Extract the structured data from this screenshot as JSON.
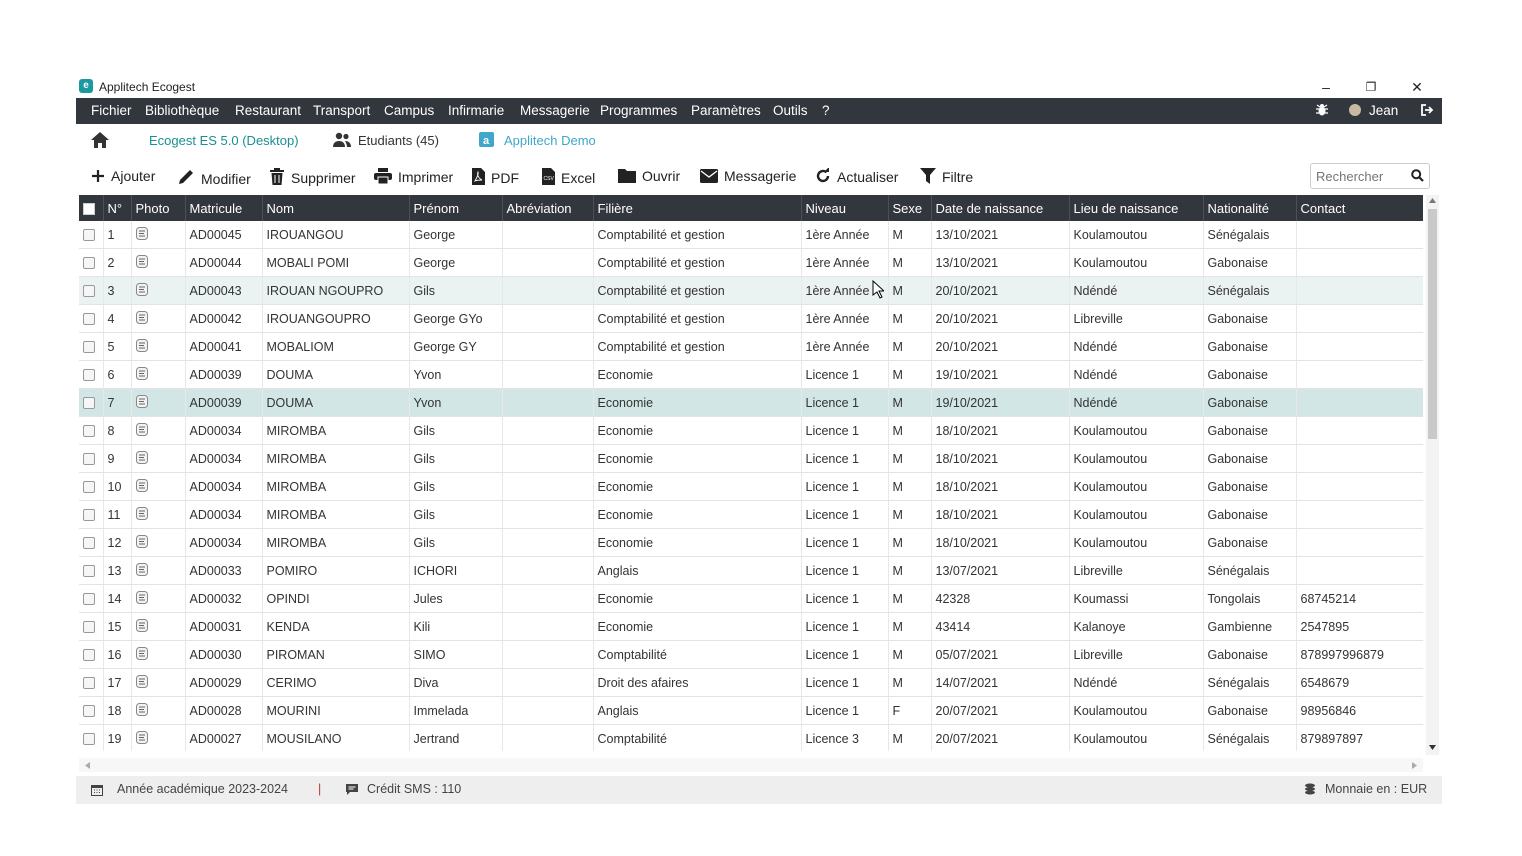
{
  "window": {
    "title": "Applitech Ecogest",
    "minimize": "–",
    "restore": "❐",
    "close": "✕"
  },
  "menu": {
    "items": [
      "Fichier",
      "Bibliothèque",
      "Restaurant",
      "Transport",
      "Campus",
      "Infirmarie",
      "Messagerie",
      "Programmes",
      "Paramètres",
      "Outils",
      "?"
    ],
    "user": "Jean"
  },
  "nav": {
    "home_icon": "home-icon",
    "version": "Ecogest ES 5.0 (Desktop)",
    "students": "Etudiants (45)",
    "company": "Applitech Demo"
  },
  "toolbar": {
    "ajouter": "Ajouter",
    "modifier": "Modifier",
    "supprimer": "Supprimer",
    "imprimer": "Imprimer",
    "pdf": "PDF",
    "excel": "Excel",
    "ouvrir": "Ouvrir",
    "messagerie": "Messagerie",
    "actualiser": "Actualiser",
    "filtre": "Filtre",
    "search_placeholder": "Rechercher"
  },
  "table": {
    "columns": [
      "N°",
      "Photo",
      "Matricule",
      "Nom",
      "Prénom",
      "Abréviation",
      "Filière",
      "Niveau",
      "Sexe",
      "Date de naissance",
      "Lieu de naissance",
      "Nationalité",
      "Contact"
    ],
    "rows": [
      {
        "n": "1",
        "matricule": "AD00045",
        "nom": "IROUANGOU",
        "prenom": "George",
        "abrev": "",
        "filiere": "Comptabilité et gestion",
        "niveau": "1ère Année",
        "sexe": "M",
        "naissance": "13/10/2021",
        "lieu": "Koulamoutou",
        "nationalite": "Sénégalais",
        "contact": ""
      },
      {
        "n": "2",
        "matricule": "AD00044",
        "nom": "MOBALI POMI",
        "prenom": "George",
        "abrev": "",
        "filiere": "Comptabilité et gestion",
        "niveau": "1ère Année",
        "sexe": "M",
        "naissance": "13/10/2021",
        "lieu": "Koulamoutou",
        "nationalite": "Gabonaise",
        "contact": ""
      },
      {
        "n": "3",
        "matricule": "AD00043",
        "nom": "IROUAN NGOUPRO",
        "prenom": "Gils",
        "abrev": "",
        "filiere": "Comptabilité et gestion",
        "niveau": "1ère Année",
        "sexe": "M",
        "naissance": "20/10/2021",
        "lieu": "Ndéndé",
        "nationalite": "Sénégalais",
        "contact": ""
      },
      {
        "n": "4",
        "matricule": "AD00042",
        "nom": "IROUANGOUPRO",
        "prenom": "George GYo",
        "abrev": "",
        "filiere": "Comptabilité et gestion",
        "niveau": "1ère Année",
        "sexe": "M",
        "naissance": "20/10/2021",
        "lieu": "Libreville",
        "nationalite": "Gabonaise",
        "contact": ""
      },
      {
        "n": "5",
        "matricule": "AD00041",
        "nom": "MOBALIOM",
        "prenom": "George GY",
        "abrev": "",
        "filiere": "Comptabilité et gestion",
        "niveau": "1ère Année",
        "sexe": "M",
        "naissance": "20/10/2021",
        "lieu": "Ndéndé",
        "nationalite": "Gabonaise",
        "contact": ""
      },
      {
        "n": "6",
        "matricule": "AD00039",
        "nom": "DOUMA",
        "prenom": "Yvon",
        "abrev": "",
        "filiere": "Economie",
        "niveau": "Licence 1",
        "sexe": "M",
        "naissance": "19/10/2021",
        "lieu": "Ndéndé",
        "nationalite": "Gabonaise",
        "contact": ""
      },
      {
        "n": "7",
        "matricule": "AD00039",
        "nom": "DOUMA",
        "prenom": "Yvon",
        "abrev": "",
        "filiere": "Economie",
        "niveau": "Licence 1",
        "sexe": "M",
        "naissance": "19/10/2021",
        "lieu": "Ndéndé",
        "nationalite": "Gabonaise",
        "contact": ""
      },
      {
        "n": "8",
        "matricule": "AD00034",
        "nom": "MIROMBA",
        "prenom": "Gils",
        "abrev": "",
        "filiere": "Economie",
        "niveau": "Licence 1",
        "sexe": "M",
        "naissance": "18/10/2021",
        "lieu": "Koulamoutou",
        "nationalite": "Gabonaise",
        "contact": ""
      },
      {
        "n": "9",
        "matricule": "AD00034",
        "nom": "MIROMBA",
        "prenom": "Gils",
        "abrev": "",
        "filiere": "Economie",
        "niveau": "Licence 1",
        "sexe": "M",
        "naissance": "18/10/2021",
        "lieu": "Koulamoutou",
        "nationalite": "Gabonaise",
        "contact": ""
      },
      {
        "n": "10",
        "matricule": "AD00034",
        "nom": "MIROMBA",
        "prenom": "Gils",
        "abrev": "",
        "filiere": "Economie",
        "niveau": "Licence 1",
        "sexe": "M",
        "naissance": "18/10/2021",
        "lieu": "Koulamoutou",
        "nationalite": "Gabonaise",
        "contact": ""
      },
      {
        "n": "11",
        "matricule": "AD00034",
        "nom": "MIROMBA",
        "prenom": "Gils",
        "abrev": "",
        "filiere": "Economie",
        "niveau": "Licence 1",
        "sexe": "M",
        "naissance": "18/10/2021",
        "lieu": "Koulamoutou",
        "nationalite": "Gabonaise",
        "contact": ""
      },
      {
        "n": "12",
        "matricule": "AD00034",
        "nom": "MIROMBA",
        "prenom": "Gils",
        "abrev": "",
        "filiere": "Economie",
        "niveau": "Licence 1",
        "sexe": "M",
        "naissance": "18/10/2021",
        "lieu": "Koulamoutou",
        "nationalite": "Gabonaise",
        "contact": ""
      },
      {
        "n": "13",
        "matricule": "AD00033",
        "nom": "POMIRO",
        "prenom": "ICHORI",
        "abrev": "",
        "filiere": "Anglais",
        "niveau": "Licence 1",
        "sexe": "M",
        "naissance": "13/07/2021",
        "lieu": "Libreville",
        "nationalite": "Sénégalais",
        "contact": ""
      },
      {
        "n": "14",
        "matricule": "AD00032",
        "nom": "OPINDI",
        "prenom": "Jules",
        "abrev": "",
        "filiere": "Economie",
        "niveau": "Licence 1",
        "sexe": "M",
        "naissance": "42328",
        "lieu": "Koumassi",
        "nationalite": "Tongolais",
        "contact": "68745214"
      },
      {
        "n": "15",
        "matricule": "AD00031",
        "nom": "KENDA",
        "prenom": "Kili",
        "abrev": "",
        "filiere": "Economie",
        "niveau": "Licence 1",
        "sexe": "M",
        "naissance": "43414",
        "lieu": "Kalanoye",
        "nationalite": "Gambienne",
        "contact": "2547895"
      },
      {
        "n": "16",
        "matricule": "AD00030",
        "nom": "PIROMAN",
        "prenom": "SIMO",
        "abrev": "",
        "filiere": "Comptabilité",
        "niveau": "Licence 1",
        "sexe": "M",
        "naissance": "05/07/2021",
        "lieu": "Libreville",
        "nationalite": "Gabonaise",
        "contact": "878997996879"
      },
      {
        "n": "17",
        "matricule": "AD00029",
        "nom": "CERIMO",
        "prenom": "Diva",
        "abrev": "",
        "filiere": "Droit des afaires",
        "niveau": "Licence 1",
        "sexe": "M",
        "naissance": "14/07/2021",
        "lieu": "Ndéndé",
        "nationalite": "Sénégalais",
        "contact": "6548679"
      },
      {
        "n": "18",
        "matricule": "AD00028",
        "nom": "MOURINI",
        "prenom": "Immelada",
        "abrev": "",
        "filiere": "Anglais",
        "niveau": "Licence 1",
        "sexe": "F",
        "naissance": "20/07/2021",
        "lieu": "Koulamoutou",
        "nationalite": "Gabonaise",
        "contact": "98956846"
      },
      {
        "n": "19",
        "matricule": "AD00027",
        "nom": "MOUSILANO",
        "prenom": "Jertrand",
        "abrev": "",
        "filiere": "Comptabilité",
        "niveau": "Licence 3",
        "sexe": "M",
        "naissance": "20/07/2021",
        "lieu": "Koulamoutou",
        "nationalite": "Sénégalais",
        "contact": "879897897"
      }
    ]
  },
  "status": {
    "annee": "Année académique 2023-2024",
    "separator": "|",
    "sms": "Crédit SMS : 110",
    "monnaie": "Monnaie en : EUR"
  },
  "colors": {
    "dark_bar": "#32373d",
    "accent": "#1a9aa0",
    "link": "#3fa7c9",
    "selected_row": "#d2e7e5",
    "hover_row": "#eaf3f2"
  }
}
